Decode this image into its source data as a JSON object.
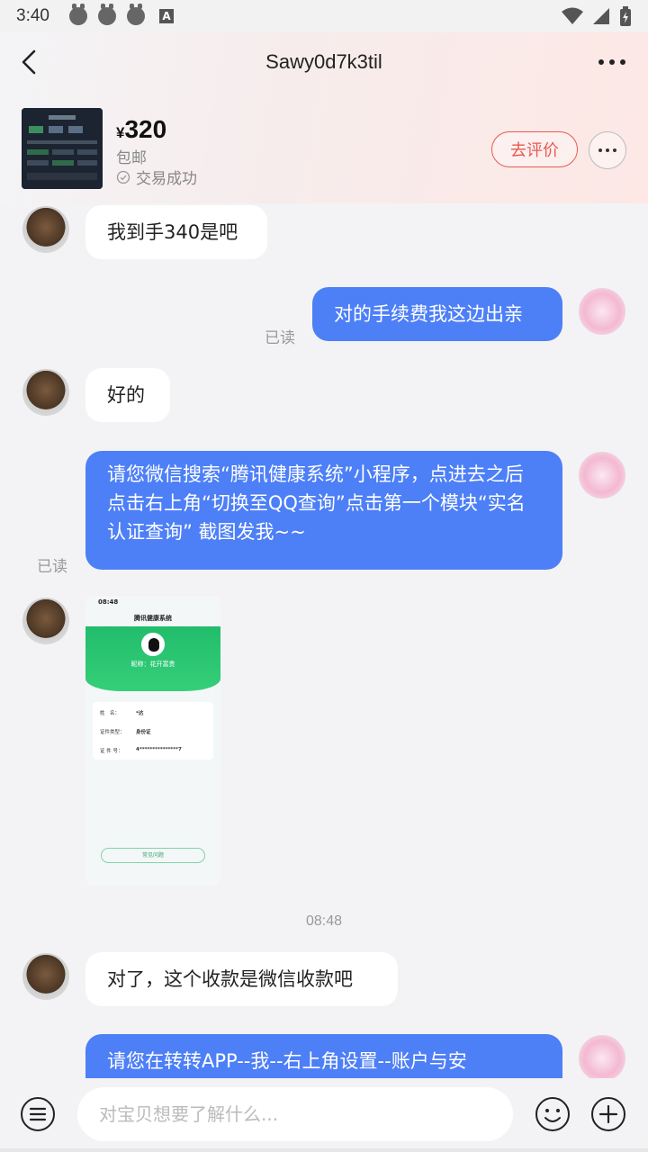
{
  "status_bar": {
    "time": "3:40",
    "icons": [
      "android-bug-icon",
      "android-bug-icon",
      "android-bug-icon",
      "a-letter-icon",
      "wifi-icon",
      "signal-icon",
      "battery-icon"
    ],
    "a_icon_letter": "A"
  },
  "header": {
    "title": "Sawy0d7k3til",
    "back_icon": "chevron-left-icon",
    "more_icon": "more-dots-icon"
  },
  "product": {
    "currency": "¥",
    "price": "320",
    "shipping": "包邮",
    "status": "交易成功",
    "review_label": "去评价",
    "thumb_icon": "product-screenshot-thumbnail"
  },
  "messages": [
    {
      "from": "seller",
      "text": "我到手340是吧"
    },
    {
      "from": "me",
      "text": "对的手续费我这边出亲",
      "read": "已读"
    },
    {
      "from": "seller",
      "text": "好的"
    },
    {
      "from": "me",
      "text": "请您微信搜索“腾讯健康系统”小程序，点进去之后点击右上角“切换至QQ查询”点击第一个模块“实名认证查询” 截图发我~~",
      "read": "已读"
    },
    {
      "from": "seller",
      "type": "image"
    },
    {
      "from": "seller",
      "text": "对了，这个收款是微信收款吧"
    },
    {
      "from": "me",
      "text": "请您在转转APP--我--右上角设置--账户与安"
    }
  ],
  "time_separator": "08:48",
  "screenshot": {
    "status_time": "08:48",
    "title": "腾讯健康系统",
    "nickname": "昵称：花开富贵",
    "field_name_label": "姓　名：",
    "field_name_value": "*达",
    "field_type_label": "证件类型：",
    "field_type_value": "身份证",
    "field_id_label": "证 件 号：",
    "field_id_value": "4***************7",
    "faq_button": "常见问题"
  },
  "input": {
    "placeholder": "对宝贝想要了解什么..."
  },
  "colors": {
    "accent_blue": "#4d7ff7",
    "review_red": "#e8594f",
    "qq_green": "#22bd6c"
  }
}
